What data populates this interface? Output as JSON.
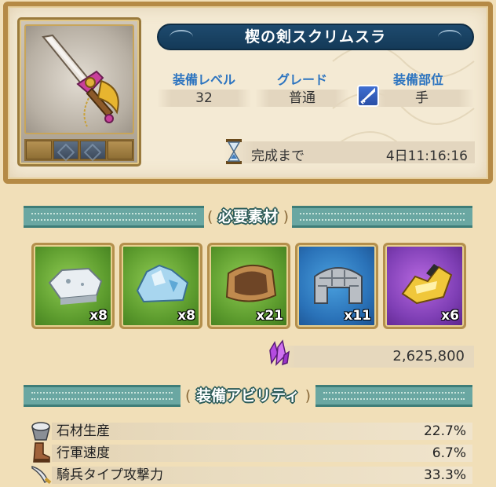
{
  "item": {
    "name": "楔の剣スクリムスラ",
    "equip_level_label": "装備レベル",
    "equip_level": "32",
    "grade_label": "グレード",
    "grade": "普通",
    "slot_label": "装備部位",
    "slot": "手",
    "slot_icon": "sword-icon",
    "timer_label": "完成まで",
    "timer_value": "4日11:16:16",
    "gem_slots": 2
  },
  "materials_section": {
    "title": "必要素材",
    "items": [
      {
        "icon": "white-stone-icon",
        "qty": "x8",
        "bg": "green"
      },
      {
        "icon": "blue-crystal-ore-icon",
        "qty": "x8",
        "bg": "green"
      },
      {
        "icon": "leather-hide-icon",
        "qty": "x21",
        "bg": "green"
      },
      {
        "icon": "steel-plate-armor-icon",
        "qty": "x11",
        "bg": "blue"
      },
      {
        "icon": "gold-ornament-icon",
        "qty": "x6",
        "bg": "purple"
      }
    ],
    "cost_icon": "purple-crystal-icon",
    "cost": "2,625,800"
  },
  "abilities_section": {
    "title": "装備アビリティ",
    "items": [
      {
        "icon": "stone-bucket-icon",
        "name": "石材生産",
        "value": "22.7%"
      },
      {
        "icon": "boot-icon",
        "name": "行軍速度",
        "value": "6.7%"
      },
      {
        "icon": "cavalry-saber-icon",
        "name": "騎兵タイプ攻撃力",
        "value": "33.3%"
      }
    ]
  }
}
